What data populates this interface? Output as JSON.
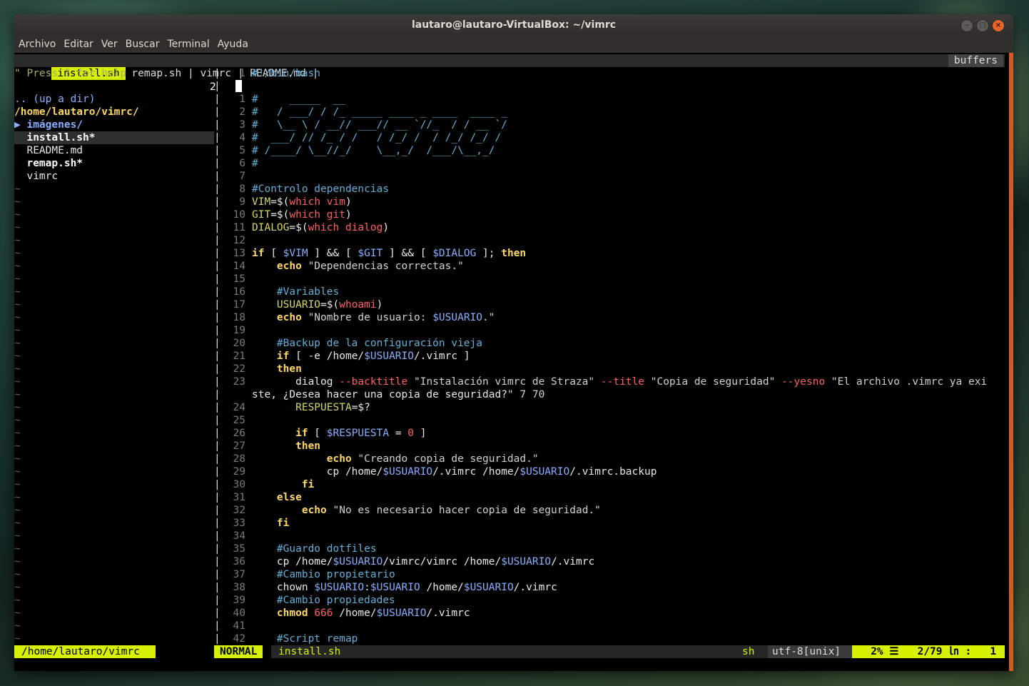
{
  "window": {
    "title": "lautaro@lautaro-VirtualBox: ~/vimrc",
    "menu": [
      "Archivo",
      "Editar",
      "Ver",
      "Buscar",
      "Terminal",
      "Ayuda"
    ]
  },
  "tabline": {
    "active_tab": "install.sh",
    "tabs": " remap.sh | vimrc | README.md |",
    "buffers_label": "buffers"
  },
  "tree": {
    "help": "\" Press ? for help",
    "up": ".. (up a dir)",
    "cwd": "/home/lautaro/vimrc/",
    "entries": [
      "▶ imágenes/",
      "  install.sh*",
      "  README.md",
      "  remap.sh*",
      "  vimrc"
    ]
  },
  "code": {
    "cursor_line": "2",
    "lines": [
      [
        "1",
        "#!/bin/bash"
      ],
      [
        "1",
        "#     _____  __"
      ],
      [
        "2",
        "#   / ___/ / /_ _____ ____ _ ____  ____ _"
      ],
      [
        "3",
        "#   \\__ \\ / __// ___// __ `//_  / / __ `/"
      ],
      [
        "4",
        "#  ___/ // /_ / /   / /_/ /  / /_/ /_/ /"
      ],
      [
        "5",
        "# /____/ \\__//_/    \\__,_/  /___/\\__,_/"
      ],
      [
        "6",
        "#"
      ],
      [
        "7",
        ""
      ],
      [
        "8",
        "#Controlo dependencias"
      ],
      [
        "9",
        "VIM=$(which vim)"
      ],
      [
        "10",
        "GIT=$(which git)"
      ],
      [
        "11",
        "DIALOG=$(which dialog)"
      ],
      [
        "12",
        ""
      ],
      [
        "13",
        "if [ $VIM ] && [ $GIT ] && [ $DIALOG ]; then"
      ],
      [
        "14",
        "    echo \"Dependencias correctas.\""
      ],
      [
        "15",
        ""
      ],
      [
        "16",
        "    #Variables"
      ],
      [
        "17",
        "    USUARIO=$(whoami)"
      ],
      [
        "18",
        "    echo \"Nombre de usuario: $USUARIO.\""
      ],
      [
        "19",
        ""
      ],
      [
        "20",
        "    #Backup de la configuración vieja"
      ],
      [
        "21",
        "    if [ -e /home/$USUARIO/.vimrc ]"
      ],
      [
        "22",
        "    then"
      ],
      [
        "23",
        "       dialog --backtitle \"Instalación vimrc de Straza\" --title \"Copia de seguridad\" --yesno \"El archivo .vimrc ya exi"
      ],
      [
        "",
        "ste, ¿Desea hacer una copia de seguridad?\" 7 70"
      ],
      [
        "24",
        "       RESPUESTA=$?"
      ],
      [
        "25",
        ""
      ],
      [
        "26",
        "       if [ $RESPUESTA = 0 ]"
      ],
      [
        "27",
        "       then"
      ],
      [
        "28",
        "            echo \"Creando copia de seguridad.\""
      ],
      [
        "29",
        "            cp /home/$USUARIO/.vimrc /home/$USUARIO/.vimrc.backup"
      ],
      [
        "30",
        "        fi"
      ],
      [
        "31",
        "    else"
      ],
      [
        "32",
        "        echo \"No es necesario hacer copia de seguridad.\""
      ],
      [
        "33",
        "    fi"
      ],
      [
        "34",
        ""
      ],
      [
        "35",
        "    #Guardo dotfiles"
      ],
      [
        "36",
        "    cp /home/$USUARIO/vimrc/vimrc /home/$USUARIO/.vimrc"
      ],
      [
        "37",
        "    #Cambio propietario"
      ],
      [
        "38",
        "    chown $USUARIO:$USUARIO /home/$USUARIO/.vimrc"
      ],
      [
        "39",
        "    #Cambio propiedades"
      ],
      [
        "40",
        "    chmod 666 /home/$USUARIO/.vimrc"
      ],
      [
        "41",
        ""
      ],
      [
        "42",
        "    #Script remap"
      ]
    ]
  },
  "statusline": {
    "tree_path": "/home/lautaro/vimrc",
    "mode": "NORMAL",
    "file": "install.sh",
    "filetype": "sh",
    "encoding": "utf-8[unix]",
    "percent": "2%",
    "position": "2/79",
    "column": "1"
  }
}
